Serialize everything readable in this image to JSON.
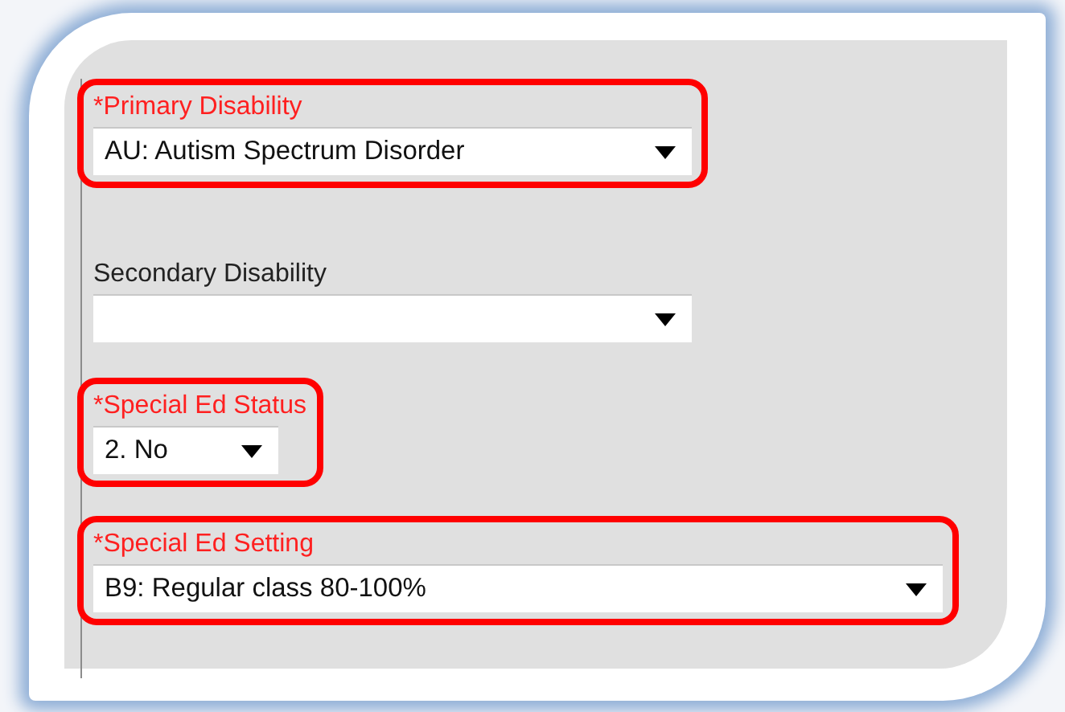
{
  "fields": [
    {
      "label": "*Primary Disability",
      "required": true,
      "highlighted": true,
      "kind": "medium",
      "value": "AU: Autism Spectrum Disorder"
    },
    {
      "label": "Secondary Disability",
      "required": false,
      "highlighted": false,
      "kind": "medium"
    },
    {
      "label": "*Special Ed Status",
      "required": true,
      "highlighted": true,
      "kind": "short",
      "value": "2. No"
    },
    {
      "label": "*Special Ed Setting",
      "required": true,
      "highlighted": true,
      "kind": "wide",
      "value": "B9: Regular class 80-100%"
    }
  ]
}
